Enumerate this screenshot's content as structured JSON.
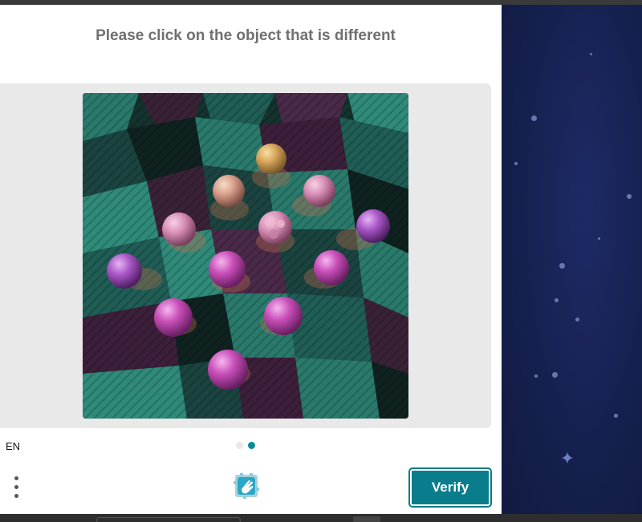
{
  "challenge": {
    "prompt": "Please click on the object that is different",
    "language": "EN",
    "progress": {
      "current_step": 2,
      "total_steps": 2
    },
    "verify_label": "Verify"
  },
  "icons": {
    "menu": "more-vertical-icon",
    "logo": "hcaptcha-hand-icon"
  },
  "colors": {
    "accent": "#0a7d8c",
    "prompt_text": "#707070",
    "background_space": "#16204f"
  }
}
